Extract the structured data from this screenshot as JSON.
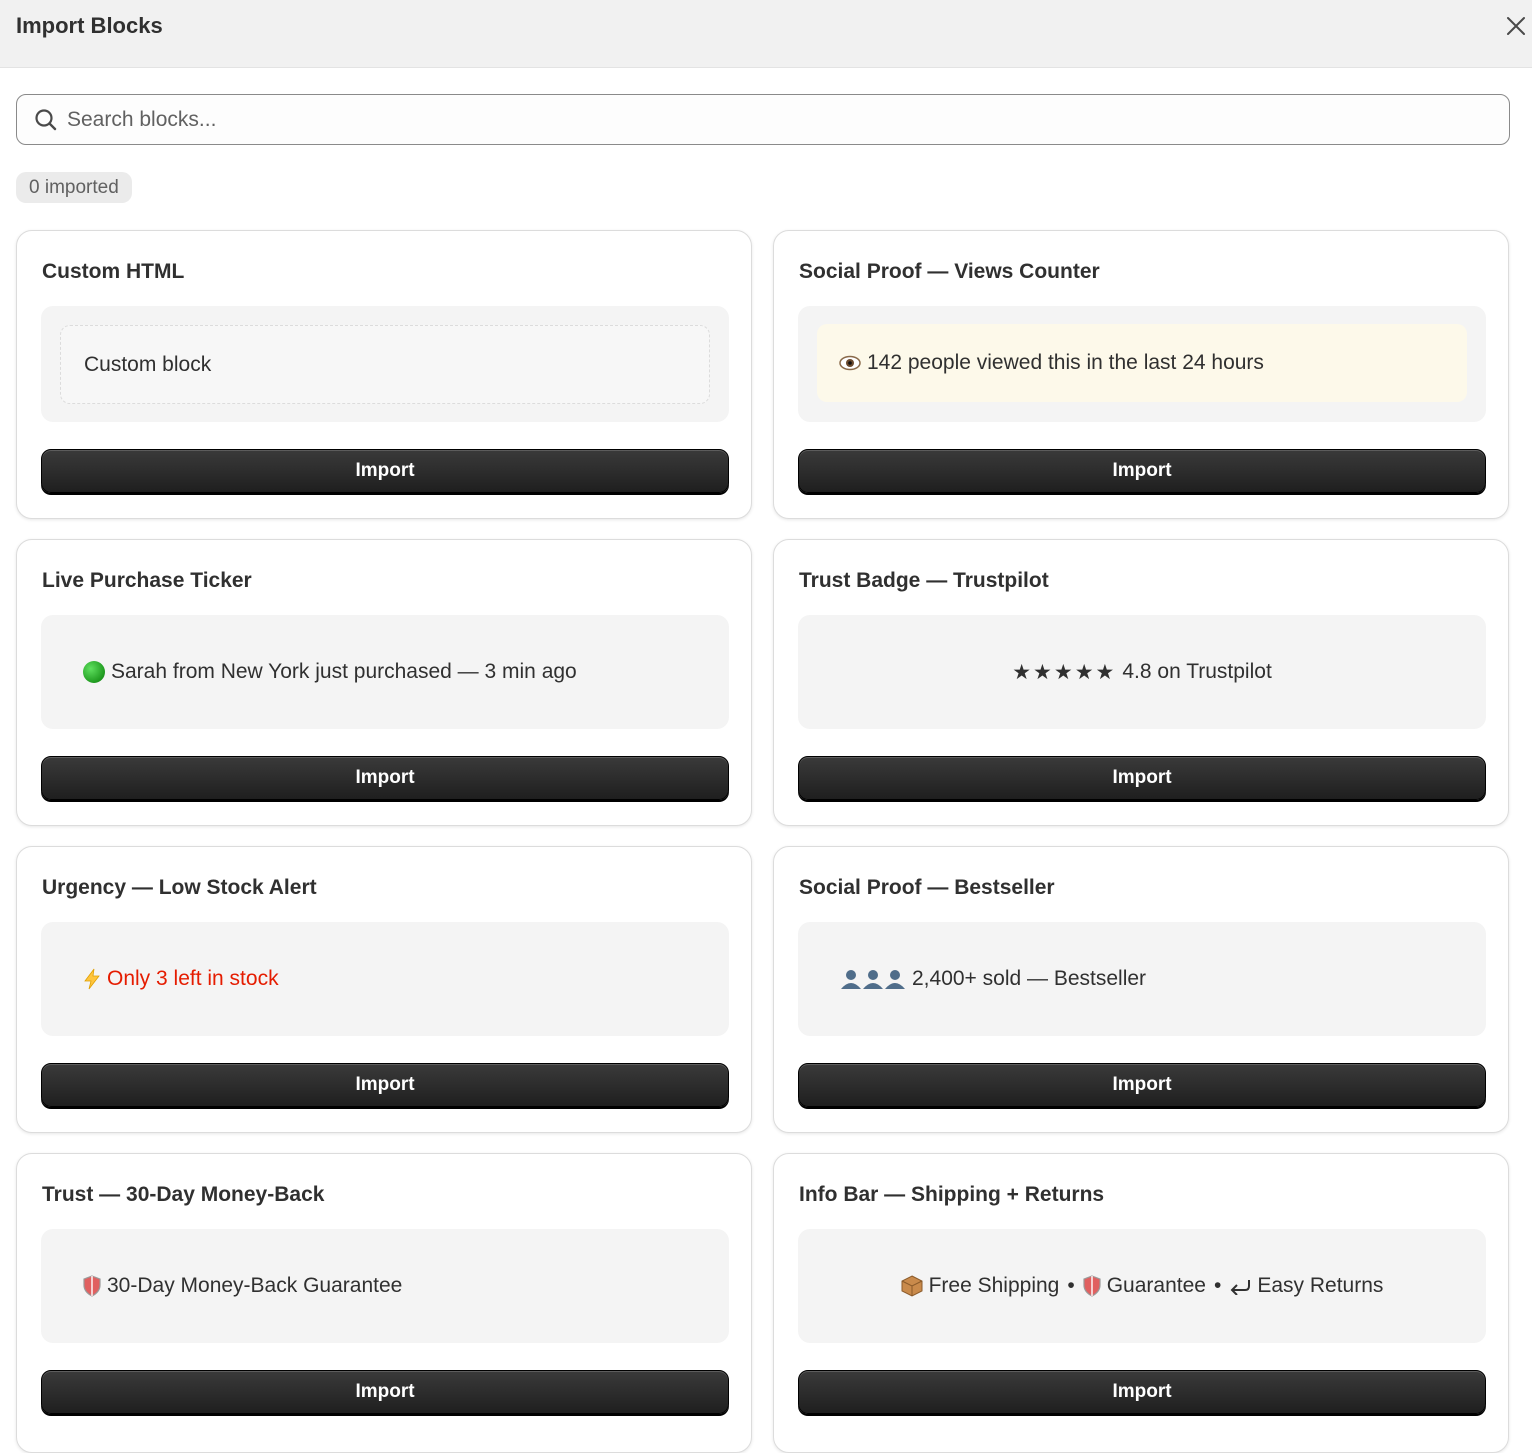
{
  "header": {
    "title": "Import Blocks"
  },
  "search": {
    "placeholder": "Search blocks..."
  },
  "count_badge": "0 imported",
  "cards": [
    {
      "title": "Custom HTML",
      "preview": "Custom block",
      "button": "Import"
    },
    {
      "title": "Social Proof — Views Counter",
      "preview": "142 people viewed this in the last 24 hours",
      "preview_icon": "eye-icon",
      "button": "Import"
    },
    {
      "title": "Live Purchase Ticker",
      "preview": "Sarah from New York just purchased — 3 min ago",
      "preview_icon": "green-circle-icon",
      "button": "Import"
    },
    {
      "title": "Trust Badge — Trustpilot",
      "preview_stars": "★★★★★",
      "preview": "4.8 on Trustpilot",
      "button": "Import"
    },
    {
      "title": "Urgency — Low Stock Alert",
      "preview": "Only 3 left in stock",
      "preview_icon": "lightning-icon",
      "preview_color": "#e51c00",
      "button": "Import"
    },
    {
      "title": "Social Proof — Bestseller",
      "preview": "2,400+ sold — Bestseller",
      "preview_icon": "people-icon",
      "button": "Import"
    },
    {
      "title": "Trust — 30-Day Money-Back",
      "preview": "30-Day Money-Back Guarantee",
      "preview_icon": "shield-icon",
      "button": "Import"
    },
    {
      "title": "Info Bar — Shipping + Returns",
      "preview_parts": [
        "Free Shipping",
        "Guarantee",
        "Easy Returns"
      ],
      "preview_icons": [
        "package-icon",
        "shield-icon",
        "return-arrow-icon"
      ],
      "separator": "•",
      "button": "Import"
    }
  ]
}
